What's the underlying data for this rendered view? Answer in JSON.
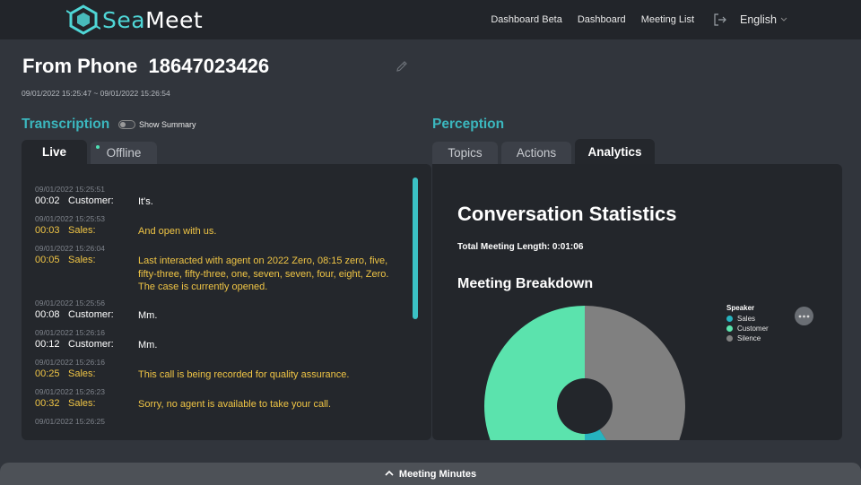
{
  "app": {
    "logo_prefix": "Sea",
    "logo_suffix": "Meet"
  },
  "nav": {
    "items": [
      "Dashboard Beta",
      "Dashboard",
      "Meeting List"
    ],
    "language": "English"
  },
  "meeting": {
    "title": "From Phone  18647023426",
    "date_range": "09/01/2022 15:25:47 ~ 09/01/2022 15:26:54"
  },
  "transcription": {
    "heading": "Transcription",
    "toggle_label": "Show Summary",
    "tabs": [
      "Live",
      "Offline"
    ],
    "entries": [
      {
        "ts": "09/01/2022 15:25:51",
        "time": "00:02",
        "speaker": "Customer:",
        "role": "customer",
        "text": "It's."
      },
      {
        "ts": "09/01/2022 15:25:53",
        "time": "00:03",
        "speaker": "Sales:",
        "role": "sales",
        "text": "And open with us."
      },
      {
        "ts": "09/01/2022 15:26:04",
        "time": "00:05",
        "speaker": "Sales:",
        "role": "sales",
        "text": "Last interacted with agent on 2022 Zero, 08:15 zero, five, fifty-three, fifty-three, one, seven, seven, four, eight, Zero. The case is currently opened."
      },
      {
        "ts": "09/01/2022 15:25:56",
        "time": "00:08",
        "speaker": "Customer:",
        "role": "customer",
        "text": "Mm."
      },
      {
        "ts": "09/01/2022 15:26:16",
        "time": "00:12",
        "speaker": "Customer:",
        "role": "customer",
        "text": "Mm."
      },
      {
        "ts": "09/01/2022 15:26:16",
        "time": "00:25",
        "speaker": "Sales:",
        "role": "sales",
        "text": "This call is being recorded for quality assurance."
      },
      {
        "ts": "09/01/2022 15:26:23",
        "time": "00:32",
        "speaker": "Sales:",
        "role": "sales",
        "text": "Sorry, no agent is available to take your call."
      },
      {
        "ts": "09/01/2022 15:26:25",
        "time": "",
        "speaker": "",
        "role": "customer",
        "text": ""
      }
    ]
  },
  "perception": {
    "heading": "Perception",
    "tabs": [
      "Topics",
      "Actions",
      "Analytics"
    ],
    "stats_title": "Conversation Statistics",
    "total_length": "Total Meeting Length: 0:01:06",
    "breakdown_title": "Meeting Breakdown"
  },
  "chart_data": {
    "type": "pie",
    "title": "Meeting Breakdown",
    "legend_title": "Speaker",
    "categories": [
      "Sales",
      "Customer",
      "Silence"
    ],
    "values": [
      9,
      50,
      41
    ],
    "colors": [
      "#26b3bf",
      "#5be3ad",
      "#808080"
    ],
    "legend_position": "right"
  },
  "footer": {
    "label": "Meeting Minutes"
  }
}
